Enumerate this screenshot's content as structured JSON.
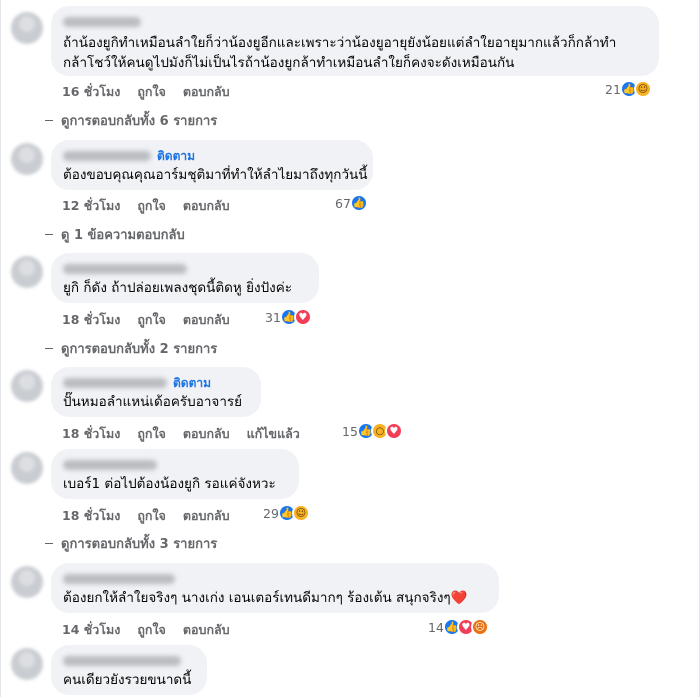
{
  "comments": [
    {
      "text_lines": [
        "ถ้าน้องยูกิทำเหมือนลำใยก็ว่าน้องยูอีกและเพราะว่าน้องยูอายุยังน้อยแต่ลำใยอายุมากแล้วก็กล้าทำ",
        "กล้าโชว์ให้คนดูไปมังก็ไม่เป็นไรถ้าน้องยูกล้าทำเหมือนลำใยก็คงจะดังเหมือนกัน"
      ],
      "time": "16 ชั่วโมง",
      "like": "ถูกใจ",
      "reply": "ตอบกลับ",
      "reaction_count": "21",
      "reaction_icons": [
        "like-icon",
        "haha-icon"
      ]
    },
    {
      "follow": "ติดตาม",
      "text_lines": [
        "ต้องขอบคุณคุณอาร์มชุติมาที่ทำให้ลำไยมาถึงทุกวันนี้"
      ],
      "time": "12 ชั่วโมง",
      "like": "ถูกใจ",
      "reply": "ตอบกลับ",
      "reaction_count": "67",
      "reaction_icons": [
        "like-icon"
      ]
    },
    {
      "text_lines": [
        "ยูกิ ก็ดัง ถ้าปล่อยเพลงชุดนี้ติดหู ยิ่งปังค่ะ"
      ],
      "time": "18 ชั่วโมง",
      "like": "ถูกใจ",
      "reply": "ตอบกลับ",
      "reaction_count": "31",
      "reaction_icons": [
        "like-icon",
        "love-icon"
      ]
    },
    {
      "follow": "ติดตาม",
      "text_lines": [
        "ปั๊นหมอลำแหน่เด้อครับอาจารย์"
      ],
      "time": "18 ชั่วโมง",
      "like": "ถูกใจ",
      "reply": "ตอบกลับ",
      "edited": "แก้ไขแล้ว",
      "reaction_count": "15",
      "reaction_icons": [
        "like-icon",
        "wow-icon",
        "love-icon"
      ]
    },
    {
      "text_lines": [
        "เบอร์1 ต่อไปต้องน้องยูกิ รอแค่จังหวะ"
      ],
      "time": "18 ชั่วโมง",
      "like": "ถูกใจ",
      "reply": "ตอบกลับ",
      "reaction_count": "29",
      "reaction_icons": [
        "like-icon",
        "haha-icon"
      ]
    },
    {
      "text_lines": [
        "ต้องยกให้ลำใยจริงๆ นางเก่ง เอนเตอร์เทนดีมากๆ ร้องเต้น สนุกจริงๆ❤️"
      ],
      "time": "14 ชั่วโมง",
      "like": "ถูกใจ",
      "reply": "ตอบกลับ",
      "reaction_count": "14",
      "reaction_icons": [
        "like-icon",
        "love-icon",
        "angry-icon"
      ]
    },
    {
      "text_lines": [
        "คนเดียวยังรวยขนาดนี้"
      ]
    }
  ],
  "reply_links": [
    "ดูการตอบกลับทั้ง 6 รายการ",
    "ดู 1 ข้อความตอบกลับ",
    "ดูการตอบกลับทั้ง 2 รายการ",
    "ดูการตอบกลับทั้ง 3 รายการ"
  ],
  "colors": {
    "bubble": "#f0f2f5",
    "meta": "#65676b",
    "link": "#1b74e4",
    "like": "#1877f2",
    "love": "#f33e58"
  }
}
